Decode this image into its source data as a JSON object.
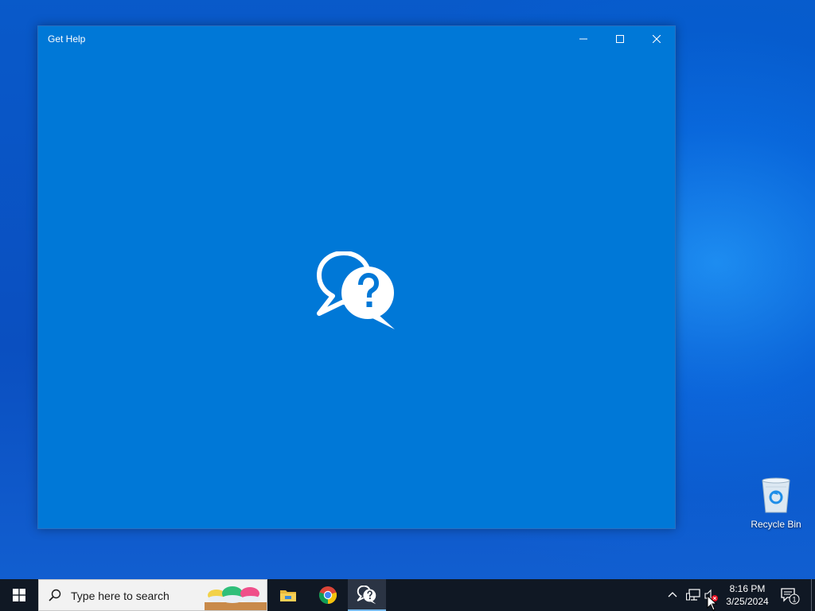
{
  "window": {
    "title": "Get Help",
    "minimize_icon": "minimize-icon",
    "maximize_icon": "maximize-icon",
    "close_icon": "close-icon",
    "splash_icon": "get-help-chat-question-icon",
    "background_color": "#0078d7"
  },
  "desktop": {
    "recycle_bin_label": "Recycle Bin"
  },
  "taskbar": {
    "start_icon": "windows-logo-icon",
    "search_placeholder": "Type here to search",
    "apps": [
      {
        "name": "File Explorer",
        "icon": "folder-icon"
      },
      {
        "name": "Google Chrome",
        "icon": "chrome-icon"
      },
      {
        "name": "Get Help",
        "icon": "get-help-icon",
        "active": true
      }
    ],
    "tray": {
      "chevron_icon": "chevron-up-icon",
      "network_icon": "network-icon",
      "volume_icon": "volume-muted-icon",
      "time": "8:16 PM",
      "date": "3/25/2024",
      "notification_count": "1"
    }
  },
  "colors": {
    "taskbar": "#101824",
    "accent": "#0078d7"
  }
}
